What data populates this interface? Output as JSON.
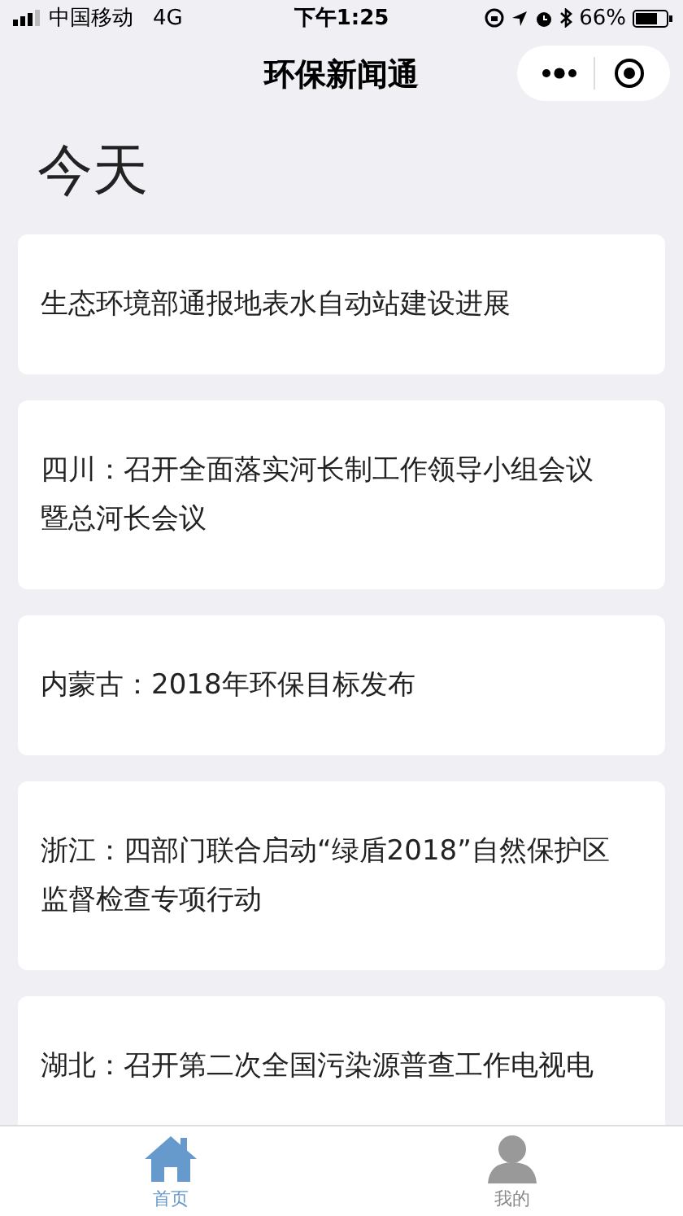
{
  "status_bar": {
    "carrier": "中国移动",
    "network": "4G",
    "time": "下午1:25",
    "battery": "66%"
  },
  "nav_bar": {
    "title": "环保新闻通"
  },
  "section_title": "今天",
  "news": [
    {
      "title": "生态环境部通报地表水自动站建设进展"
    },
    {
      "title": "四川：召开全面落实河长制工作领导小组会议暨总河长会议"
    },
    {
      "title": "内蒙古：2018年环保目标发布"
    },
    {
      "title": "浙江：四部门联合启动“绿盾2018”自然保护区监督检查专项行动"
    },
    {
      "title": "湖北：召开第二次全国污染源普查工作电视电"
    }
  ],
  "tab_bar": [
    {
      "label": "首页",
      "kind": "home",
      "selected": true
    },
    {
      "label": "我的",
      "kind": "profile",
      "selected": false
    }
  ]
}
